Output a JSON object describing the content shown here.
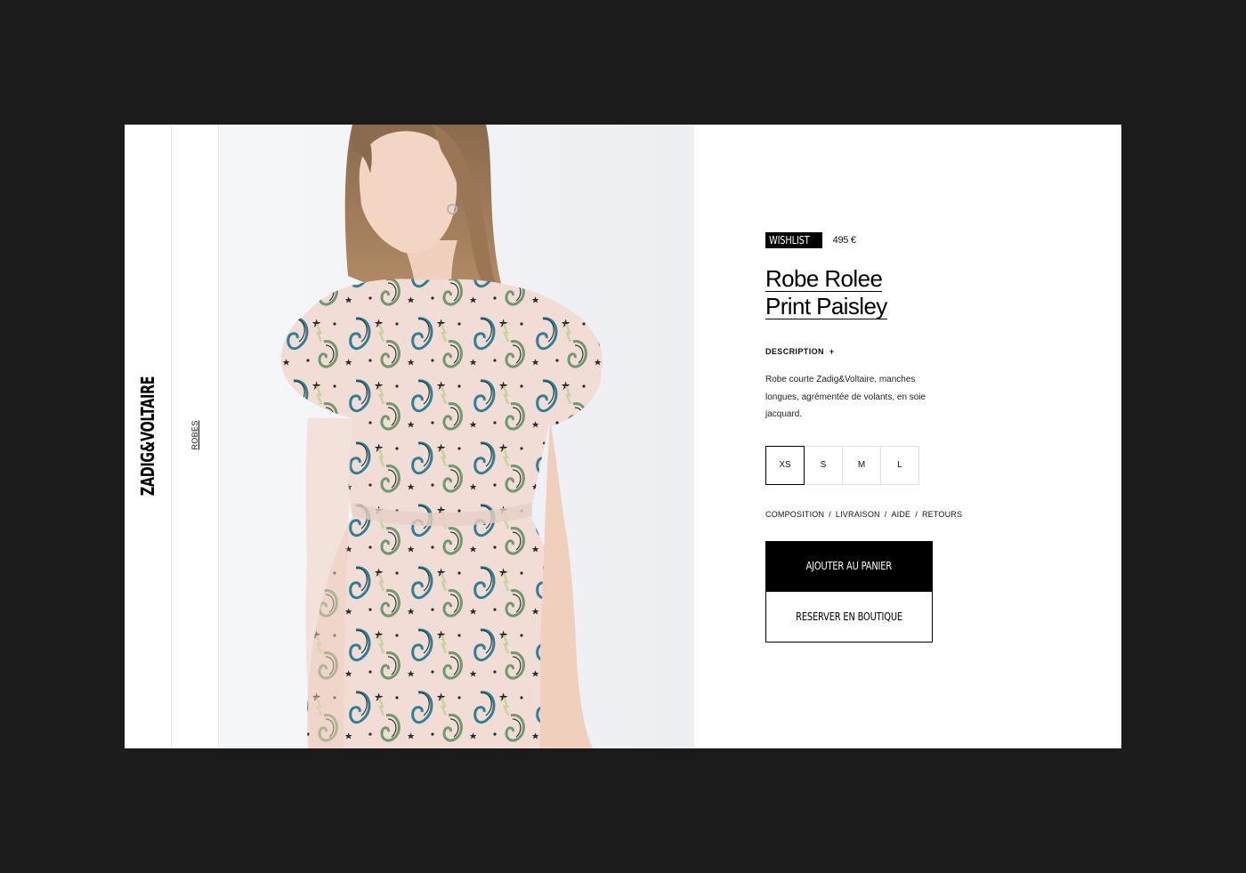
{
  "brand": {
    "name": "ZADIG&VOLTAIRE"
  },
  "breadcrumb": {
    "category": "ROBES"
  },
  "product": {
    "wishlist_label": "WISHLIST",
    "price": "495 €",
    "title_line1": "Robe Rolee",
    "title_line2": "Print Paisley",
    "description_label": "DESCRIPTION",
    "description_toggle": "+",
    "description_text": "Robe courte Zadig&Voltaire, manches longues, agrémentée de volants, en soie jacquard.",
    "sizes": [
      "XS",
      "S",
      "M",
      "L"
    ],
    "selected_size": "XS"
  },
  "info_links": {
    "composition": "COMPOSITION",
    "livraison": "LIVRAISON",
    "aide": "AIDE",
    "retours": "RETOURS",
    "separator": "/"
  },
  "actions": {
    "add_to_cart": "AJOUTER AU PANIER",
    "reserve": "RESERVER EN BOUTIQUE"
  },
  "colors": {
    "page_background": "#1b1b1b",
    "frame_background": "#ffffff",
    "accent": "#000000",
    "dress_base": "#f1ddd6",
    "paisley_teal": "#2f7f95",
    "paisley_green": "#6f9a6d"
  }
}
